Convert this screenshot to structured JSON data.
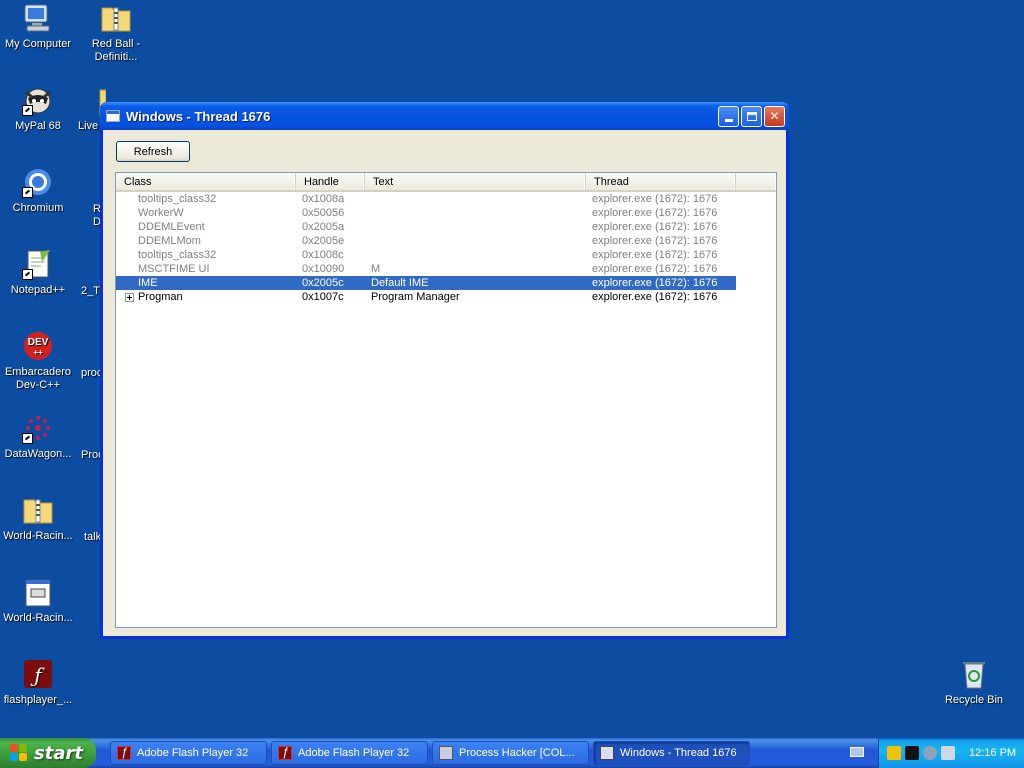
{
  "desktop": {
    "icons": [
      {
        "label": "My Computer"
      },
      {
        "label": "Red Ball - Definiti..."
      },
      {
        "label": "MyPal 68"
      },
      {
        "label": "Live"
      },
      {
        "label": "Chromium"
      },
      {
        "label": "R D"
      },
      {
        "label": "Notepad++"
      },
      {
        "label": "2_T"
      },
      {
        "label": "Embarcadero Dev-C++"
      },
      {
        "label": "proc"
      },
      {
        "label": "DataWagon..."
      },
      {
        "label": "Proc"
      },
      {
        "label": "World-Racin..."
      },
      {
        "label": "talk"
      },
      {
        "label": "World-Racin..."
      },
      {
        "label": "flashplayer_..."
      },
      {
        "label": "Recycle Bin"
      }
    ],
    "dev_icon_text": "DEV"
  },
  "window": {
    "title": "Windows - Thread 1676",
    "refresh_label": "Refresh",
    "columns": [
      "Class",
      "Handle",
      "Text",
      "Thread"
    ],
    "rows": [
      {
        "class": "tooltips_class32",
        "handle": "0x1008a",
        "text": "",
        "thread": "explorer.exe (1672): 1676"
      },
      {
        "class": "WorkerW",
        "handle": "0x50056",
        "text": "",
        "thread": "explorer.exe (1672): 1676"
      },
      {
        "class": "DDEMLEvent",
        "handle": "0x2005a",
        "text": "",
        "thread": "explorer.exe (1672): 1676"
      },
      {
        "class": "DDEMLMom",
        "handle": "0x2005e",
        "text": "",
        "thread": "explorer.exe (1672): 1676"
      },
      {
        "class": "tooltips_class32",
        "handle": "0x1008c",
        "text": "",
        "thread": "explorer.exe (1672): 1676"
      },
      {
        "class": "MSCTFIME UI",
        "handle": "0x10090",
        "text": "M",
        "thread": "explorer.exe (1672): 1676"
      },
      {
        "class": "IME",
        "handle": "0x2005c",
        "text": "Default IME",
        "thread": "explorer.exe (1672): 1676"
      },
      {
        "class": "Progman",
        "handle": "0x1007c",
        "text": "Program Manager",
        "thread": "explorer.exe (1672): 1676"
      }
    ]
  },
  "taskbar": {
    "start_label": "start",
    "tasks": [
      {
        "label": "Adobe Flash Player 32",
        "icon": "flash-icon"
      },
      {
        "label": "Adobe Flash Player 32",
        "icon": "flash-icon"
      },
      {
        "label": "Process Hacker [COL...",
        "icon": "process-hacker-icon"
      },
      {
        "label": "Windows - Thread 1676",
        "icon": "window-icon"
      }
    ],
    "clock": "12:16 PM"
  }
}
